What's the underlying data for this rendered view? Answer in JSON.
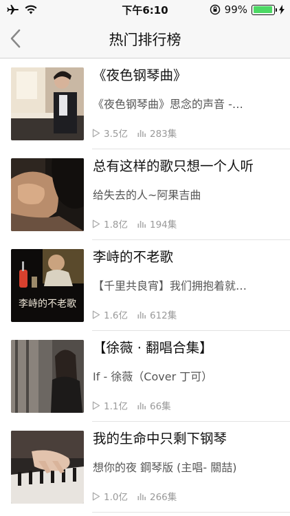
{
  "status_bar": {
    "time": "下午6:10",
    "battery_percent": "99%",
    "battery_level": 0.99
  },
  "nav": {
    "title": "热门排行榜"
  },
  "items": [
    {
      "title": "《夜色钢琴曲》",
      "subtitle": "《夜色钢琴曲》思念的声音 -…",
      "plays": "3.5亿",
      "episodes": "283集"
    },
    {
      "title": "总有这样的歌只想一个人听",
      "subtitle": "给失去的人~阿果吉曲",
      "plays": "1.8亿",
      "episodes": "194集"
    },
    {
      "title": "李峙的不老歌",
      "subtitle": "【千里共良宵】我们拥抱着就…",
      "plays": "1.6亿",
      "episodes": "612集",
      "thumb_text": "李峙的不老歌"
    },
    {
      "title": "【徐薇 · 翻唱合集】",
      "subtitle": "If - 徐薇（Cover 丁可）",
      "plays": "1.1亿",
      "episodes": "66集"
    },
    {
      "title": "我的生命中只剩下钢琴",
      "subtitle": "想你的夜 鋼琴版 (主唱- 關喆)",
      "plays": "1.0亿",
      "episodes": "266集"
    }
  ]
}
